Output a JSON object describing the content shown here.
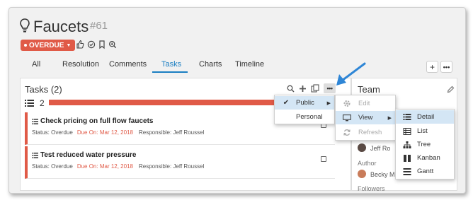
{
  "header": {
    "title": "Faucets",
    "number": "#61",
    "status": "OVERDUE"
  },
  "tabs": [
    {
      "label": "All"
    },
    {
      "label": "Resolution"
    },
    {
      "label": "Comments"
    },
    {
      "label": "Tasks",
      "active": true
    },
    {
      "label": "Charts"
    },
    {
      "label": "Timeline"
    }
  ],
  "tasks_panel": {
    "title": "Tasks (2)",
    "count": "2",
    "progress": 1.0,
    "items": [
      {
        "name": "Check pricing on full flow faucets",
        "status": "Status: Overdue",
        "due": "Due On: Mar 12, 2018",
        "responsible": "Responsible: Jeff Roussel"
      },
      {
        "name": "Test reduced water pressure",
        "status": "Status: Overdue",
        "due": "Due On: Mar 12, 2018",
        "responsible": "Responsible: Jeff Roussel"
      }
    ]
  },
  "team_panel": {
    "title": "Team",
    "owner_partial": "Jeff Ro",
    "author_label": "Author",
    "author_partial": "Becky M",
    "followers_label": "Followers"
  },
  "menu_privacy": {
    "items": [
      "Public",
      "Personal"
    ]
  },
  "menu_actions": {
    "items": [
      "Edit",
      "View",
      "Refresh"
    ]
  },
  "menu_view": {
    "items": [
      "Detail",
      "List",
      "Tree",
      "Kanban",
      "Gantt"
    ]
  },
  "colors": {
    "accent": "#1a7ec2",
    "overdue": "#e05a47",
    "highlight": "#d4e6f5"
  }
}
